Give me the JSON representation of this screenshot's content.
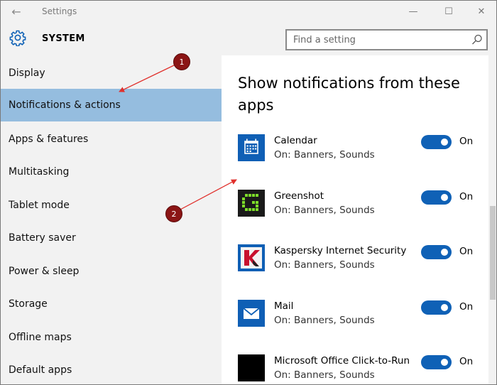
{
  "window": {
    "title": "Settings",
    "back_glyph": "←",
    "controls": {
      "minimize": "—",
      "maximize": "☐",
      "close": "✕"
    }
  },
  "header": {
    "icon": "gear-icon",
    "title": "SYSTEM",
    "search_placeholder": "Find a setting",
    "search_icon": "search-icon"
  },
  "sidebar": {
    "items": [
      {
        "label": "Display",
        "active": false
      },
      {
        "label": "Notifications & actions",
        "active": true
      },
      {
        "label": "Apps & features",
        "active": false
      },
      {
        "label": "Multitasking",
        "active": false
      },
      {
        "label": "Tablet mode",
        "active": false
      },
      {
        "label": "Battery saver",
        "active": false
      },
      {
        "label": "Power & sleep",
        "active": false
      },
      {
        "label": "Storage",
        "active": false
      },
      {
        "label": "Offline maps",
        "active": false
      },
      {
        "label": "Default apps",
        "active": false
      }
    ],
    "active_color": "#95bddf"
  },
  "main": {
    "section_title": "Show notifications from these apps",
    "apps": [
      {
        "name": "Calendar",
        "sub": "On: Banners, Sounds",
        "toggle": "On",
        "icon": "calendar-icon"
      },
      {
        "name": "Greenshot",
        "sub": "On: Banners, Sounds",
        "toggle": "On",
        "icon": "greenshot-icon"
      },
      {
        "name": "Kaspersky Internet Security",
        "sub": "On: Banners, Sounds",
        "toggle": "On",
        "icon": "kaspersky-icon"
      },
      {
        "name": "Mail",
        "sub": "On: Banners, Sounds",
        "toggle": "On",
        "icon": "mail-icon"
      },
      {
        "name": "Microsoft Office Click-to-Run",
        "sub": "On: Banners, Sounds",
        "toggle": "On",
        "icon": "office-icon"
      }
    ],
    "toggle_color": "#0f61b6"
  },
  "annotations": [
    {
      "label": "1",
      "color": "#8b1515"
    },
    {
      "label": "2",
      "color": "#8b1515"
    }
  ]
}
